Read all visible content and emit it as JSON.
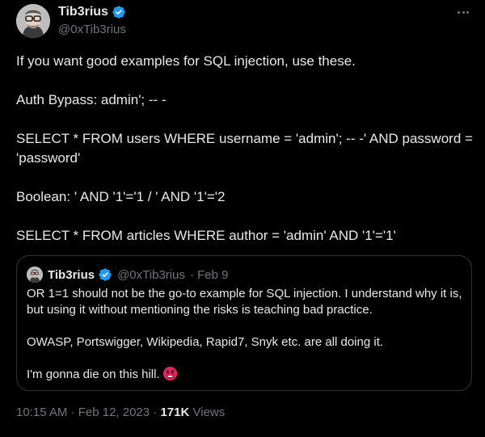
{
  "author": {
    "display_name": "Tib3rius",
    "handle": "@0xTib3rius"
  },
  "tweet": {
    "paragraphs": [
      "If you want good examples for SQL injection, use these.",
      "Auth Bypass: admin'; -- -",
      "SELECT * FROM users WHERE username = 'admin'; -- -' AND password = 'password'",
      "Boolean: ' AND '1'='1 / ' AND '1'='2",
      "SELECT * FROM articles WHERE author = 'admin' AND '1'='1'"
    ],
    "timestamp": "10:15 AM · Feb 12, 2023",
    "separator": "·",
    "views_count": "171K",
    "views_label": "Views"
  },
  "quoted": {
    "display_name": "Tib3rius",
    "handle": "@0xTib3rius",
    "date": "· Feb 9",
    "paragraphs": [
      "OR 1=1 should not be the go-to example for SQL injection. I understand why it is, but using it without mentioning the risks is teaching bad practice.",
      "OWASP, Portswigger, Wikipedia, Rapid7, Snyk etc. are all doing it.",
      "I'm gonna die on this hill."
    ]
  },
  "icons": {
    "verified": "verified-badge-icon",
    "more": "more-options-icon",
    "emoji": "enraged-face-emoji"
  },
  "colors": {
    "background": "#000000",
    "text": "#e7e9ea",
    "muted": "#71767b",
    "verified": "#1d9bf0",
    "border": "#2f3336"
  }
}
